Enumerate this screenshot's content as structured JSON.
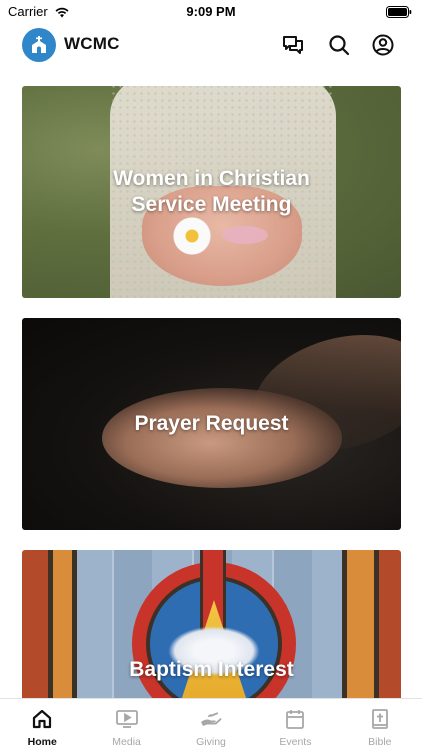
{
  "status_bar": {
    "carrier": "Carrier",
    "time": "9:09 PM"
  },
  "header": {
    "app_name": "WCMC",
    "logo_icon": "church-icon",
    "actions": [
      "chat-icon",
      "search-icon",
      "account-icon"
    ]
  },
  "cards": [
    {
      "title": "Women in Christian Service Meeting"
    },
    {
      "title": "Prayer Request"
    },
    {
      "title": "Baptism Interest"
    }
  ],
  "tab_bar": {
    "items": [
      {
        "label": "Home",
        "icon": "home-icon",
        "active": true
      },
      {
        "label": "Media",
        "icon": "media-icon",
        "active": false
      },
      {
        "label": "Giving",
        "icon": "giving-icon",
        "active": false
      },
      {
        "label": "Events",
        "icon": "calendar-icon",
        "active": false
      },
      {
        "label": "Bible",
        "icon": "bible-icon",
        "active": false
      }
    ]
  },
  "colors": {
    "brand": "#2f86c9",
    "active_tab": "#111111",
    "inactive_tab": "#a7a7a7"
  }
}
